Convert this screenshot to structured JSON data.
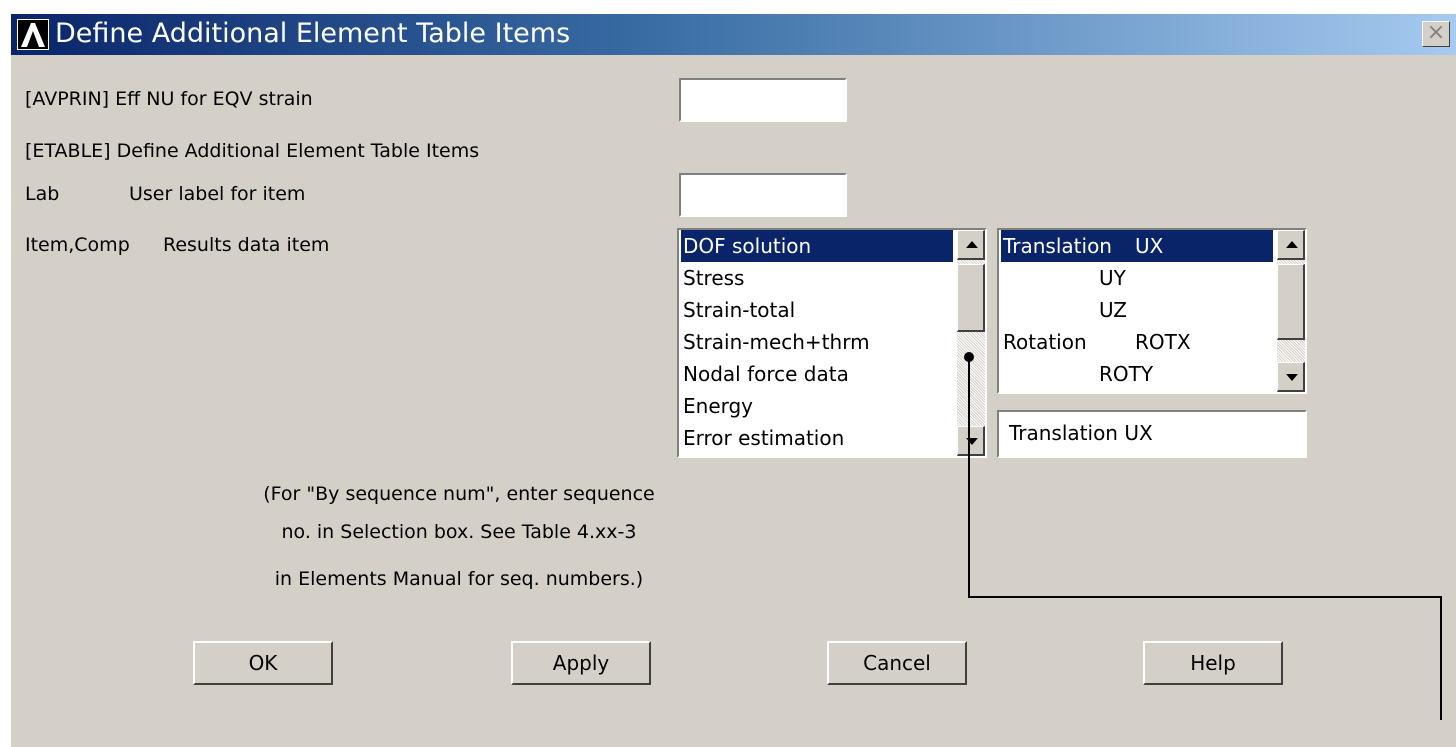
{
  "window": {
    "title": "Define Additional Element Table Items",
    "close_glyph": "×"
  },
  "avprin": {
    "label": "[AVPRIN]  Eff NU for EQV strain",
    "value": ""
  },
  "etable_heading": "[ETABLE]  Define Additional Element Table Items",
  "lab": {
    "key": "Lab",
    "label": "User label for item",
    "value": ""
  },
  "item": {
    "key": "Item,Comp",
    "label": "Results data item"
  },
  "item_list": [
    "DOF solution",
    "Stress",
    "Strain-total",
    "Strain-mech+thrm",
    "Nodal force data",
    "Energy",
    "Error estimation"
  ],
  "comp_list": [
    {
      "group": "Translation",
      "comp": "UX"
    },
    {
      "group": "",
      "comp": "UY"
    },
    {
      "group": "",
      "comp": "UZ"
    },
    {
      "group": "Rotation",
      "comp": "ROTX"
    },
    {
      "group": "",
      "comp": "ROTY"
    }
  ],
  "selection": "Translation   UX",
  "note_lines": [
    "(For \"By sequence num\", enter sequence",
    "no. in Selection box.  See Table 4.xx-3",
    "in Elements Manual for seq. numbers.)"
  ],
  "buttons": {
    "ok": "OK",
    "apply": "Apply",
    "cancel": "Cancel",
    "help": "Help"
  },
  "icons": {
    "logo": "ansys-logo-icon",
    "close": "close-icon"
  },
  "colors": {
    "title_start": "#0a246a",
    "title_end": "#a6caf0",
    "selection": "#0a246a",
    "dialog": "#d4d0c8"
  }
}
